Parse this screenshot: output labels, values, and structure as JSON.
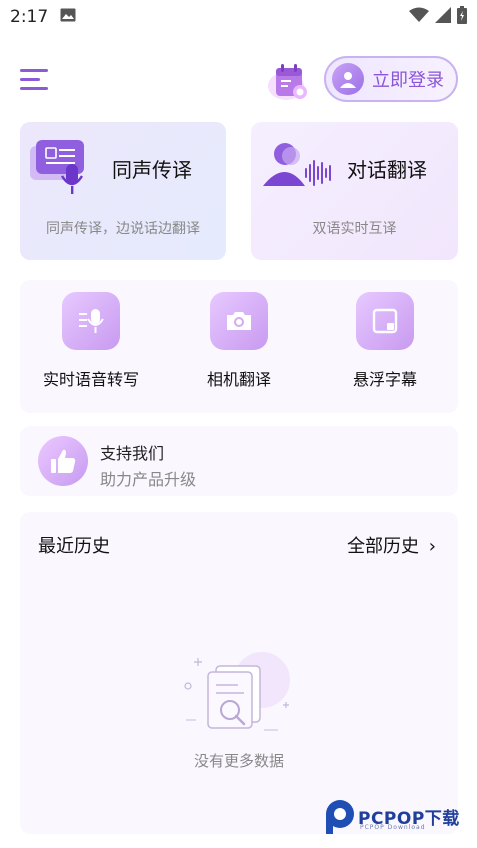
{
  "status_bar": {
    "time": "2:17"
  },
  "header": {
    "login_label": "立即登录"
  },
  "cards": {
    "simultaneous": {
      "title": "同声传译",
      "subtitle": "同声传译，边说话边翻译"
    },
    "dialog": {
      "title": "对话翻译",
      "subtitle": "双语实时互译"
    }
  },
  "tools": [
    {
      "label": "实时语音转写",
      "icon": "voice-transcribe-icon"
    },
    {
      "label": "相机翻译",
      "icon": "camera-icon"
    },
    {
      "label": "悬浮字幕",
      "icon": "floating-window-icon"
    }
  ],
  "support": {
    "title": "支持我们",
    "subtitle": "助力产品升级"
  },
  "history": {
    "title": "最近历史",
    "all_label": "全部历史",
    "empty_text": "没有更多数据"
  },
  "watermark": {
    "text": "PCPOP下载",
    "sub": "PCPOP Download"
  },
  "colors": {
    "accent": "#8a55d9",
    "card_bg": "#faf7ff"
  }
}
